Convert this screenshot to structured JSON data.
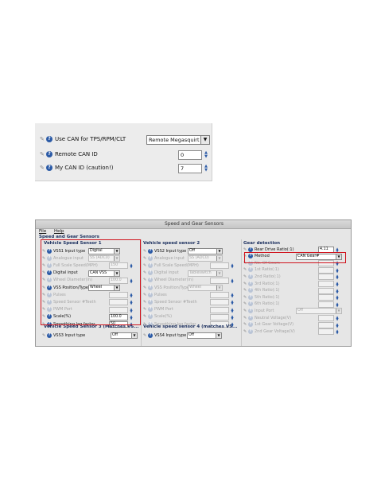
{
  "can_panel": {
    "rows": [
      {
        "label": "Use CAN for TPS/RPM/CLT",
        "control": "dropdown",
        "value": "Remote Megasquirt"
      },
      {
        "label": "Remote CAN ID",
        "control": "spinner",
        "value": "0"
      },
      {
        "label": "My CAN ID (caution!)",
        "control": "spinner",
        "value": "7"
      }
    ]
  },
  "window": {
    "title": "Speed and Gear Sensors",
    "menu": [
      "File",
      "Help"
    ],
    "section_title": "Speed and Gear Sensors",
    "vss1": {
      "title": "Vehicle Speed Sensor 1",
      "rows": [
        {
          "label": "VSS1 Input type",
          "value": "Digital",
          "dim": false
        },
        {
          "label": "Analogue input",
          "value": "SS (ADC0)",
          "dim": true
        },
        {
          "label": "Full Scale Speed(MPH)",
          "value": "150",
          "dim": true
        },
        {
          "label": "Digital input",
          "value": "CAN VSS",
          "dim": false
        },
        {
          "label": "Wheel Diameter(in)",
          "value": "100.0",
          "dim": true
        },
        {
          "label": "VSS Position/Type",
          "value": "Wheel",
          "dim": false
        },
        {
          "label": "Pulses",
          "value": "",
          "dim": true
        },
        {
          "label": "Speed Sensor #Teeth",
          "value": "",
          "dim": true
        },
        {
          "label": "PWM Port",
          "value": "",
          "dim": true
        },
        {
          "label": "Scale(%)",
          "value": "100.0",
          "dim": false
        },
        {
          "label": "Smoothing lag factor",
          "value": "50",
          "dim": false
        }
      ]
    },
    "vss2": {
      "title": "Vehicle speed sensor 2",
      "rows": [
        {
          "label": "VSS2 Input type",
          "value": "Off",
          "dim": false
        },
        {
          "label": "Analogue input",
          "value": "SS (ADC0)",
          "dim": true
        },
        {
          "label": "Full Scale Speed(MPH)",
          "value": "",
          "dim": true
        },
        {
          "label": "Digital input",
          "value": "Tableswitch",
          "dim": true
        },
        {
          "label": "Wheel Diameter(in)",
          "value": "",
          "dim": true
        },
        {
          "label": "VSS Position/Type",
          "value": "Wheel",
          "dim": true
        },
        {
          "label": "Pulses",
          "value": "",
          "dim": true
        },
        {
          "label": "Speed Sensor #Teeth",
          "value": "",
          "dim": true
        },
        {
          "label": "PWM Port",
          "value": "",
          "dim": true
        },
        {
          "label": "Scale(%)",
          "value": "",
          "dim": true
        },
        {
          "label": "Smoothing lag factor",
          "value": "",
          "dim": true
        }
      ]
    },
    "gear": {
      "title": "Gear detection",
      "rows": [
        {
          "label": "Rear Drive Ratio(:1)",
          "value": "4.11",
          "dim": false
        },
        {
          "label": "Method",
          "value": "CAN Gear#",
          "dim": false
        },
        {
          "label": "No. Of Gears",
          "value": "",
          "dim": true
        },
        {
          "label": "1st Ratio(:1)",
          "value": "",
          "dim": true
        },
        {
          "label": "2nd Ratio(:1)",
          "value": "",
          "dim": true
        },
        {
          "label": "3rd Ratio(:1)",
          "value": "",
          "dim": true
        },
        {
          "label": "4th Ratio(:1)",
          "value": "",
          "dim": true
        },
        {
          "label": "5th Ratio(:1)",
          "value": "",
          "dim": true
        },
        {
          "label": "6th Ratio(:1)",
          "value": "",
          "dim": true
        },
        {
          "label": "Input Port",
          "value": "Off",
          "dim": true
        },
        {
          "label": "Neutral Voltage(V)",
          "value": "",
          "dim": true
        },
        {
          "label": "1st Gear Voltage(V)",
          "value": "",
          "dim": true
        },
        {
          "label": "2nd Gear Voltage(V)",
          "value": "",
          "dim": true
        }
      ]
    },
    "vss3": {
      "title": "Vehicle Speed Sensor 3 (Matches VS...",
      "row_label": "VSS3 Input type",
      "value": "Off"
    },
    "vss4": {
      "title": "Vehicle speed sensor 4 (matches VS...",
      "row_label": "VSS4 Input type",
      "value": "Off"
    }
  }
}
